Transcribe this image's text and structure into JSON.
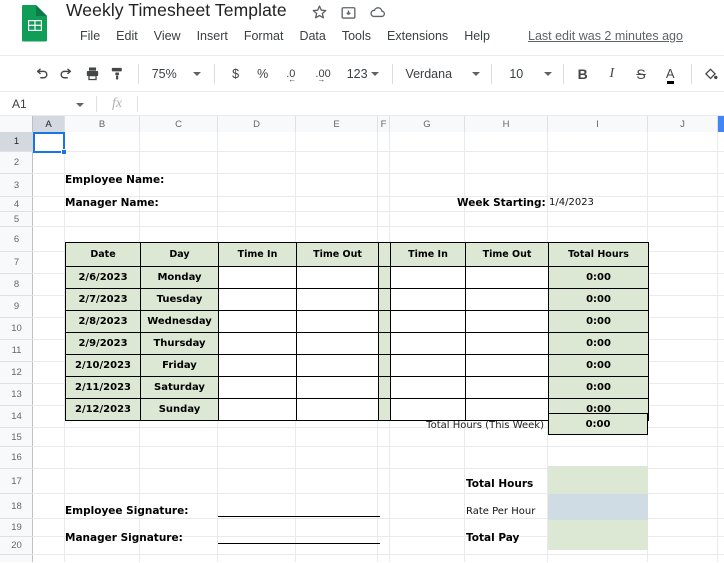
{
  "app": {
    "logo_icon": "sheets-logo-icon",
    "title": "Weekly Timesheet Template",
    "title_icons": [
      {
        "name": "star-icon",
        "label": "Star"
      },
      {
        "name": "move-to-folder-icon",
        "label": "Move"
      },
      {
        "name": "cloud-saved-icon",
        "label": "Saved to Drive"
      }
    ],
    "menus": [
      "File",
      "Edit",
      "View",
      "Insert",
      "Format",
      "Data",
      "Tools",
      "Extensions",
      "Help"
    ],
    "last_edit": "Last edit was 2 minutes ago"
  },
  "toolbar": {
    "undo_icon": "undo-icon",
    "redo_icon": "redo-icon",
    "print_icon": "print-icon",
    "paint_format_icon": "paint-format-icon",
    "zoom": "75%",
    "currency_label": "$",
    "percent_label": "%",
    "decrease_decimal_label": ".0",
    "increase_decimal_label": ".00",
    "more_formats_label": "123",
    "font": "Verdana",
    "font_size": "10",
    "bold_label": "B",
    "italic_label": "I",
    "strikethrough_label": "S",
    "text_color_label": "A",
    "fill_color_icon": "fill-color-icon"
  },
  "formula_bar": {
    "name_box": "A1",
    "fx_label": "fx",
    "formula_value": "",
    "formula_placeholder": ""
  },
  "grid": {
    "columns": [
      "A",
      "B",
      "C",
      "D",
      "E",
      "F",
      "G",
      "H",
      "I",
      "J"
    ],
    "rows": [
      "1",
      "2",
      "3",
      "4",
      "5",
      "6",
      "7",
      "8",
      "9",
      "10",
      "11",
      "12",
      "13",
      "14",
      "15",
      "16",
      "17",
      "18",
      "19",
      "20"
    ],
    "selected_cell": "A1"
  },
  "sheet": {
    "employee_name_label": "Employee Name:",
    "employee_name_value": "",
    "manager_name_label": "Manager Name:",
    "manager_name_value": "",
    "week_starting_label": "Week Starting:",
    "week_starting_value": "1/4/2023",
    "table": {
      "headers": [
        "Date",
        "Day",
        "Time In",
        "Time Out",
        "",
        "Time In",
        "Time Out",
        "Total Hours"
      ],
      "rows": [
        {
          "date": "2/6/2023",
          "day": "Monday",
          "time_in_1": "",
          "time_out_1": "",
          "time_in_2": "",
          "time_out_2": "",
          "total": "0:00"
        },
        {
          "date": "2/7/2023",
          "day": "Tuesday",
          "time_in_1": "",
          "time_out_1": "",
          "time_in_2": "",
          "time_out_2": "",
          "total": "0:00"
        },
        {
          "date": "2/8/2023",
          "day": "Wednesday",
          "time_in_1": "",
          "time_out_1": "",
          "time_in_2": "",
          "time_out_2": "",
          "total": "0:00"
        },
        {
          "date": "2/9/2023",
          "day": "Thursday",
          "time_in_1": "",
          "time_out_1": "",
          "time_in_2": "",
          "time_out_2": "",
          "total": "0:00"
        },
        {
          "date": "2/10/2023",
          "day": "Friday",
          "time_in_1": "",
          "time_out_1": "",
          "time_in_2": "",
          "time_out_2": "",
          "total": "0:00"
        },
        {
          "date": "2/11/2023",
          "day": "Saturday",
          "time_in_1": "",
          "time_out_1": "",
          "time_in_2": "",
          "time_out_2": "",
          "total": "0:00"
        },
        {
          "date": "2/12/2023",
          "day": "Sunday",
          "time_in_1": "",
          "time_out_1": "",
          "time_in_2": "",
          "time_out_2": "",
          "total": "0:00"
        }
      ],
      "week_total_label": "Total Hours (This Week)",
      "week_total_value": "0:00"
    },
    "employee_signature_label": "Employee Signature:",
    "manager_signature_label": "Manager Signature:",
    "summary": {
      "total_hours_label": "Total Hours",
      "total_hours_value": "",
      "rate_per_hour_label": "Rate Per Hour",
      "rate_per_hour_value": "",
      "total_pay_label": "Total Pay",
      "total_pay_value": ""
    }
  },
  "colors": {
    "accent": "#1a73e8",
    "sheets_green": "#0f9d58",
    "table_green": "#dce8d4",
    "rate_blue": "#cfdce4"
  }
}
